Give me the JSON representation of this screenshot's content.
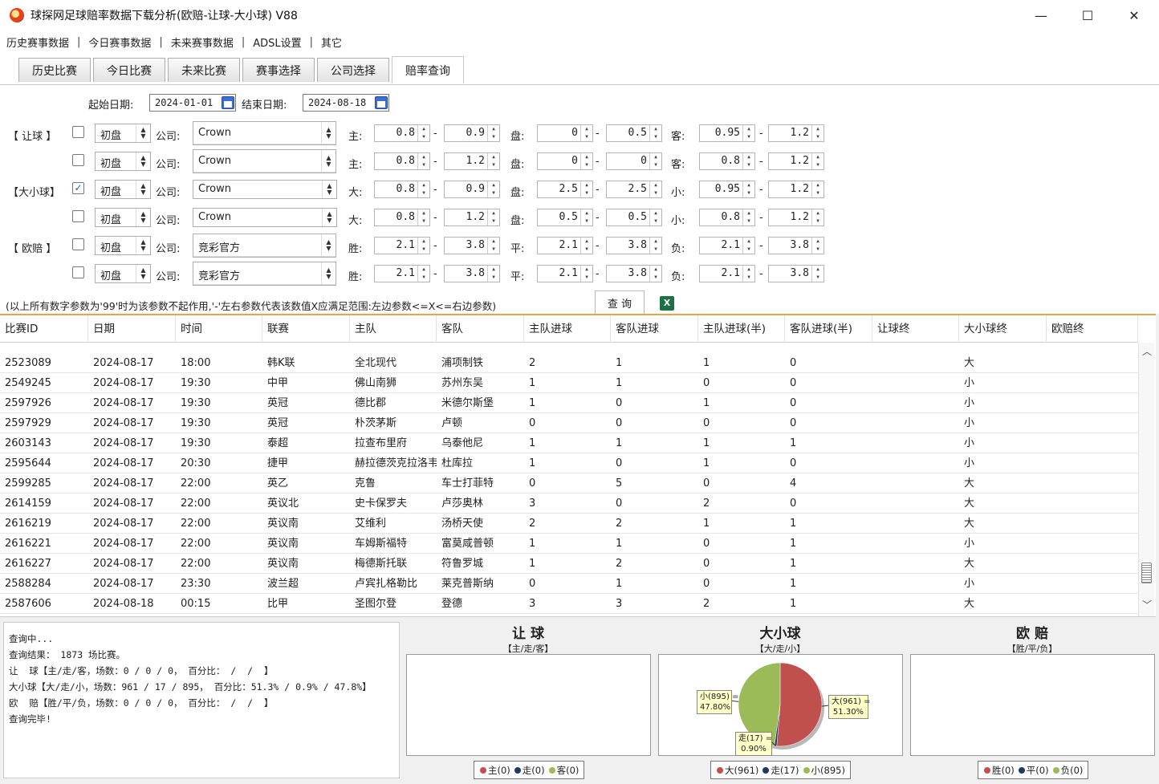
{
  "window": {
    "title": "球探网足球赔率数据下载分析(欧赔-让球-大小球) V88",
    "minimize": "—",
    "maximize": "☐",
    "close": "✕"
  },
  "menu": [
    "历史赛事数据",
    "今日赛事数据",
    "未来赛事数据",
    "ADSL设置",
    "其它"
  ],
  "menu_sep": "|",
  "tabs": [
    "历史比赛",
    "今日比赛",
    "未来比赛",
    "赛事选择",
    "公司选择",
    "赔率查询"
  ],
  "active_tab": 5,
  "date": {
    "start_label": "起始日期:",
    "start_value": "2024-01-01",
    "end_label": "结束日期:",
    "end_value": "2024-08-18"
  },
  "group_labels": {
    "handicap": "【 让球 】",
    "overunder": "【大小球】",
    "euro": "【 欧赔 】"
  },
  "common": {
    "company_label": "公司:",
    "dash": "-"
  },
  "filter_rows": [
    {
      "checked": false,
      "type": "初盘",
      "company": "Crown",
      "l1": "主:",
      "a1": "0.8",
      "a2": "0.9",
      "l2": "盘:",
      "b1": "0",
      "b2": "0.5",
      "l3": "客:",
      "c1": "0.95",
      "c2": "1.2"
    },
    {
      "checked": false,
      "type": "初盘",
      "company": "Crown",
      "l1": "主:",
      "a1": "0.8",
      "a2": "1.2",
      "l2": "盘:",
      "b1": "0",
      "b2": "0",
      "l3": "客:",
      "c1": "0.8",
      "c2": "1.2"
    },
    {
      "checked": true,
      "type": "初盘",
      "company": "Crown",
      "l1": "大:",
      "a1": "0.8",
      "a2": "0.9",
      "l2": "盘:",
      "b1": "2.5",
      "b2": "2.5",
      "l3": "小:",
      "c1": "0.95",
      "c2": "1.2"
    },
    {
      "checked": false,
      "type": "初盘",
      "company": "Crown",
      "l1": "大:",
      "a1": "0.8",
      "a2": "1.2",
      "l2": "盘:",
      "b1": "0.5",
      "b2": "0.5",
      "l3": "小:",
      "c1": "0.8",
      "c2": "1.2"
    },
    {
      "checked": false,
      "type": "初盘",
      "company": "竞彩官方",
      "l1": "胜:",
      "a1": "2.1",
      "a2": "3.8",
      "l2": "平:",
      "b1": "2.1",
      "b2": "3.8",
      "l3": "负:",
      "c1": "2.1",
      "c2": "3.8"
    },
    {
      "checked": false,
      "type": "初盘",
      "company": "竞彩官方",
      "l1": "胜:",
      "a1": "2.1",
      "a2": "3.8",
      "l2": "平:",
      "b1": "2.1",
      "b2": "3.8",
      "l3": "负:",
      "c1": "2.1",
      "c2": "3.8"
    }
  ],
  "hint": "(以上所有数字参数为'99'时为该参数不起作用,'-'左右参数代表该数值X应满足范围:左边参数<=X<=右边参数)",
  "query_button": "查 询",
  "excel_icon": "X",
  "table": {
    "columns": [
      "比赛ID",
      "日期",
      "时间",
      "联赛",
      "主队",
      "客队",
      "主队进球",
      "客队进球",
      "主队进球(半)",
      "客队进球(半)",
      "让球终",
      "大小球终",
      "欧赔终"
    ],
    "rows": [
      [
        "2523089",
        "2024-08-17",
        "18:00",
        "韩K联",
        "全北现代",
        "浦项制铁",
        "2",
        "1",
        "1",
        "0",
        "",
        "大",
        ""
      ],
      [
        "2549245",
        "2024-08-17",
        "19:30",
        "中甲",
        "佛山南狮",
        "苏州东吴",
        "1",
        "1",
        "0",
        "0",
        "",
        "小",
        ""
      ],
      [
        "2597926",
        "2024-08-17",
        "19:30",
        "英冠",
        "德比郡",
        "米德尔斯堡",
        "1",
        "0",
        "1",
        "0",
        "",
        "小",
        ""
      ],
      [
        "2597929",
        "2024-08-17",
        "19:30",
        "英冠",
        "朴茨茅斯",
        "卢顿",
        "0",
        "0",
        "0",
        "0",
        "",
        "小",
        ""
      ],
      [
        "2603143",
        "2024-08-17",
        "19:30",
        "泰超",
        "拉查布里府",
        "乌泰他尼",
        "1",
        "1",
        "1",
        "1",
        "",
        "小",
        ""
      ],
      [
        "2595644",
        "2024-08-17",
        "20:30",
        "捷甲",
        "赫拉德茨克拉洛韦",
        "杜库拉",
        "1",
        "0",
        "1",
        "0",
        "",
        "小",
        ""
      ],
      [
        "2599285",
        "2024-08-17",
        "22:00",
        "英乙",
        "克鲁",
        "车士打菲特",
        "0",
        "5",
        "0",
        "4",
        "",
        "大",
        ""
      ],
      [
        "2614159",
        "2024-08-17",
        "22:00",
        "英议北",
        "史卡保罗夫",
        "卢莎奥林",
        "3",
        "0",
        "2",
        "0",
        "",
        "大",
        ""
      ],
      [
        "2616219",
        "2024-08-17",
        "22:00",
        "英议南",
        "艾维利",
        "汤桥天使",
        "2",
        "2",
        "1",
        "1",
        "",
        "大",
        ""
      ],
      [
        "2616221",
        "2024-08-17",
        "22:00",
        "英议南",
        "车姆斯福特",
        "富莫咸普顿",
        "1",
        "1",
        "0",
        "1",
        "",
        "小",
        ""
      ],
      [
        "2616227",
        "2024-08-17",
        "22:00",
        "英议南",
        "梅德斯托联",
        "符鲁罗城",
        "1",
        "2",
        "0",
        "1",
        "",
        "大",
        ""
      ],
      [
        "2588284",
        "2024-08-17",
        "23:30",
        "波兰超",
        "卢宾扎格勒比",
        "莱克普斯纳",
        "0",
        "1",
        "0",
        "1",
        "",
        "小",
        ""
      ],
      [
        "2587606",
        "2024-08-18",
        "00:15",
        "比甲",
        "圣图尔登",
        "登德",
        "3",
        "3",
        "2",
        "1",
        "",
        "大",
        ""
      ]
    ]
  },
  "log_lines": [
    "查询中...",
    "查询结果： 1873 场比赛。",
    "让  球【主/走/客，场数：0 / 0 / 0， 百分比： /  /  】",
    "大小球【大/走/小，场数：961 / 17 / 895， 百分比：51.3% / 0.9% / 47.8%】",
    "欧  赔【胜/平/负，场数：0 / 0 / 0， 百分比： /  /  】",
    "查询完毕!"
  ],
  "charts": {
    "handicap": {
      "title": "让 球",
      "subtitle": "【主/走/客】",
      "legend": [
        "主(0)",
        "走(0)",
        "客(0)"
      ]
    },
    "overunder": {
      "title": "大小球",
      "subtitle": "【大/走/小】",
      "legend": [
        "大(961)",
        "走(17)",
        "小(895)"
      ]
    },
    "euro": {
      "title": "欧 赔",
      "subtitle": "【胜/平/负】",
      "legend": [
        "胜(0)",
        "平(0)",
        "负(0)"
      ]
    }
  },
  "chart_data": {
    "type": "pie",
    "categories": [
      "大",
      "走",
      "小"
    ],
    "values": [
      961,
      17,
      895
    ],
    "labels": [
      {
        "line1": "大(961) =",
        "line2": "51.30%"
      },
      {
        "line1": "走(17) =",
        "line2": "0.90%"
      },
      {
        "line1": "小(895) =",
        "line2": "47.80%"
      }
    ],
    "colors": [
      "#c0504d",
      "#1f3864",
      "#9bbb59"
    ]
  },
  "legend_colors": [
    "#c0504d",
    "#1f3864",
    "#9bbb59"
  ]
}
